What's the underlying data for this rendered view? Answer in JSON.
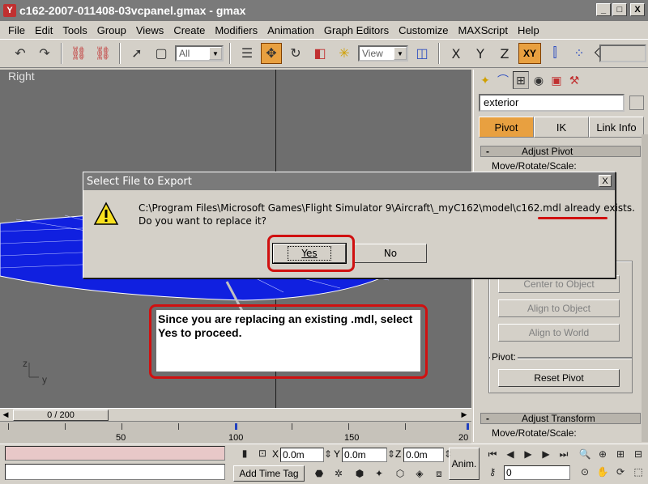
{
  "window": {
    "title": "c162-2007-011408-03vcpanel.gmax - gmax",
    "min": "_",
    "max": "□",
    "close": "X"
  },
  "menu": [
    "File",
    "Edit",
    "Tools",
    "Group",
    "Views",
    "Create",
    "Modifiers",
    "Animation",
    "Graph Editors",
    "Customize",
    "MAXScript",
    "Help"
  ],
  "toolbar": {
    "selection_filter": "All",
    "ref_coord": "View",
    "axis_x": "X",
    "axis_y": "Y",
    "axis_z": "Z",
    "axis_xy": "XY"
  },
  "viewport": {
    "label": "Right",
    "axis_z": "z",
    "axis_y": "y"
  },
  "command_panel": {
    "object_name": "exterior",
    "tabs": [
      "Pivot",
      "IK",
      "Link Info"
    ],
    "adjust_pivot": "Adjust Pivot",
    "move_rotate_scale": "Move/Rotate/Scale:",
    "center_to_object": "Center to Object",
    "align_to_object": "Align to Object",
    "align_to_world": "Align to World",
    "pivot_group": "Pivot:",
    "reset_pivot": "Reset Pivot",
    "adjust_transform": "Adjust Transform",
    "move_rotate_scale_2": "Move/Rotate/Scale:"
  },
  "timeline": {
    "frame_display": "0 / 200",
    "ticks": [
      "50",
      "100",
      "150",
      "20"
    ]
  },
  "status": {
    "x_label": "X",
    "x_value": "0.0m",
    "y_label": "Y",
    "y_value": "0.0m",
    "z_label": "Z",
    "z_value": "0.0m",
    "add_time_tag": "Add Time Tag",
    "anim_button": "Anim.",
    "frame_value": "0"
  },
  "dialog": {
    "title": "Select File to Export",
    "close": "X",
    "message_line1": "C:\\Program Files\\Microsoft Games\\Flight Simulator 9\\Aircraft\\_myC162\\model\\c162.mdl",
    "message_exists": "already exists.",
    "message_line2": "Do you want to replace it?",
    "yes": "Yes",
    "no": "No"
  },
  "callout": {
    "text": "Since you are replacing an existing .mdl, select Yes to proceed."
  }
}
